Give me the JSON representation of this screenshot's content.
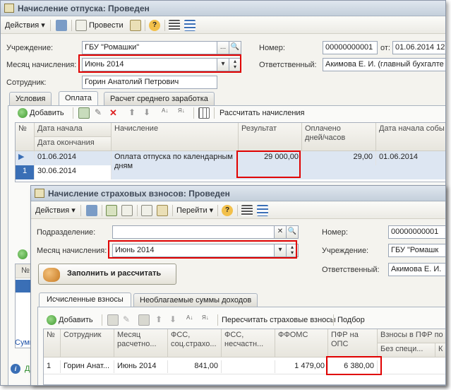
{
  "main_window": {
    "title": "Начисление отпуска: Проведен",
    "toolbar": {
      "actions": "Действия",
      "post": "Провести"
    },
    "fields": {
      "org_label": "Учреждение:",
      "org_value": "ГБУ \"Ромашки\"",
      "month_label": "Месяц начисления:",
      "month_value": "Июнь 2014",
      "employee_label": "Сотрудник:",
      "employee_value": "Горин Анатолий Петрович",
      "number_label": "Номер:",
      "number_value": "00000000001",
      "from_label": "от:",
      "date_value": "01.06.2014 12",
      "resp_label": "Ответственный:",
      "resp_value": "Акимова Е. И. (главный бухгалте"
    },
    "tabs": [
      "Условия",
      "Оплата",
      "Расчет среднего заработка"
    ],
    "grid_toolbar": {
      "add": "Добавить",
      "calc": "Рассчитать начисления"
    },
    "grid": {
      "headers": {
        "n": "№",
        "date_start": "Дата начала",
        "date_end": "Дата окончания",
        "accrual": "Начисление",
        "result": "Результат",
        "paid_l1": "Оплачено",
        "paid_l2": "дней/часов",
        "event_start": "Дата начала собы"
      },
      "row": {
        "n": "1",
        "date_start": "01.06.2014",
        "date_end": "30.06.2014",
        "accrual_l1": "Оплата отпуска по календарным",
        "accrual_l2": "дням",
        "result": "29 000,00",
        "paid": "29,00",
        "event_start": "01.06.2014"
      }
    },
    "footer": {
      "summ": "Сумм",
      "d": "Д"
    }
  },
  "front_window": {
    "title": "Начисление страховых взносов: Проведен",
    "toolbar": {
      "actions": "Действия",
      "goto": "Перейти"
    },
    "fields": {
      "dept_label": "Подразделение:",
      "dept_value": "",
      "month_label": "Месяц начисления:",
      "month_value": "Июнь 2014",
      "number_label": "Номер:",
      "number_value": "00000000001",
      "org_label": "Учреждение:",
      "org_value": "ГБУ \"Ромашк",
      "resp_label": "Ответственный:",
      "resp_value": "Акимова Е. И."
    },
    "fill_button": "Заполнить и рассчитать",
    "tabs": [
      "Исчисленные взносы",
      "Необлагаемые суммы доходов"
    ],
    "grid_toolbar": {
      "add": "Добавить",
      "recalc": "Пересчитать страховые взносы",
      "select": "Подбор"
    },
    "grid": {
      "headers": {
        "n": "№",
        "employee": "Сотрудник",
        "month_l1": "Месяц",
        "month_l2": "расчетно...",
        "fss_l1": "ФСС,",
        "fss_l2": "соц.страхо...",
        "fssns_l1": "ФСС,",
        "fssns_l2": "несчастн...",
        "ffoms": "ФФОМС",
        "pfr_l1": "ПФР на",
        "pfr_l2": "ОПС",
        "extra_l1": "Взносы в ПФР по",
        "extra_l2": "Без специ...",
        "extra_l3": "К"
      },
      "row": {
        "n": "1",
        "employee": "Горин Анат...",
        "month": "Июнь 2014",
        "fss": "841,00",
        "fssns": "",
        "ffoms": "1 479,00",
        "pfr": "6 380,00"
      }
    }
  },
  "colors": {
    "highlight": "#e00000",
    "title_text": "#404a58"
  }
}
